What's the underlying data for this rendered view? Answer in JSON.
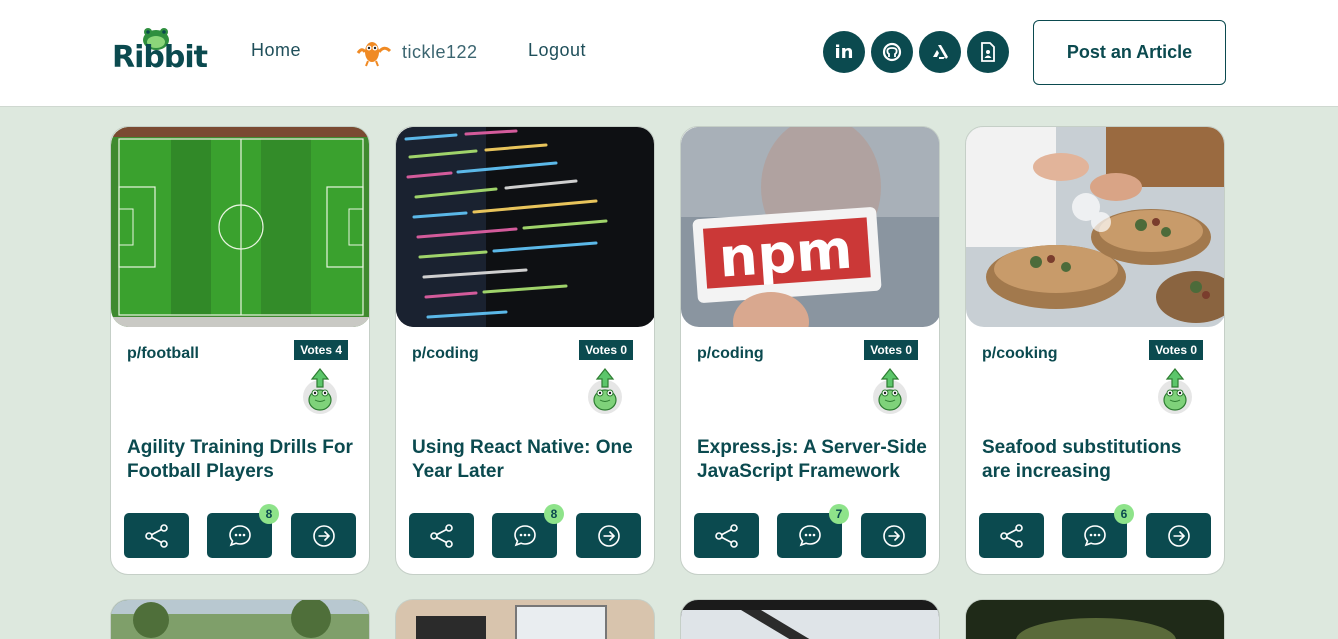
{
  "header": {
    "logo_text": "Ribbit",
    "nav": {
      "home": "Home",
      "username": "tickle122",
      "logout": "Logout"
    },
    "social": [
      "linkedin-icon",
      "github-icon",
      "artstation-icon",
      "resume-icon"
    ],
    "post_button": "Post an Article"
  },
  "articles": [
    {
      "subreddit": "p/football",
      "votes": "Votes 4",
      "title": "Agility Training Drills For Football Players",
      "comments": "8"
    },
    {
      "subreddit": "p/coding",
      "votes": "Votes 0",
      "title": "Using React Native: One Year Later",
      "comments": "8"
    },
    {
      "subreddit": "p/coding",
      "votes": "Votes 0",
      "title": "Express.js: A Server-Side JavaScript Framework",
      "comments": "7"
    },
    {
      "subreddit": "p/cooking",
      "votes": "Votes 0",
      "title": "Seafood substitutions are increasing",
      "comments": "6"
    }
  ],
  "npm_sign": "npm",
  "colors": {
    "brand": "#0b4a4f",
    "background": "#dde8de",
    "badge": "#8ee38a"
  }
}
